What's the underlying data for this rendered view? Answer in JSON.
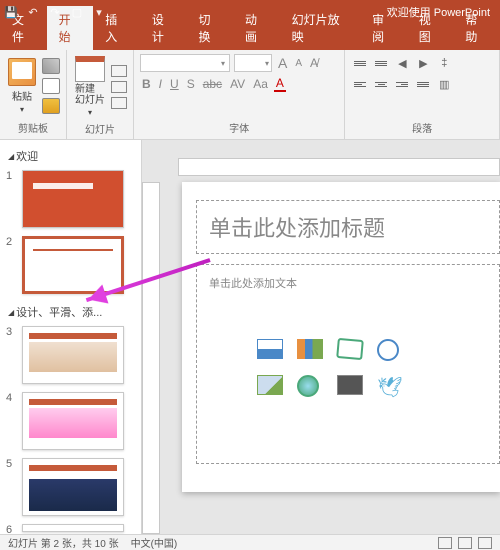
{
  "titlebar": {
    "welcome": "欢迎使用 PowerPoint"
  },
  "tabs": {
    "file": "文件",
    "home": "开始",
    "insert": "插入",
    "design": "设计",
    "transitions": "切换",
    "animations": "动画",
    "slideshow": "幻灯片放映",
    "review": "审阅",
    "view": "视图",
    "help": "帮助"
  },
  "ribbon": {
    "clipboard": {
      "label": "剪贴板",
      "paste": "粘贴"
    },
    "slides": {
      "label": "幻灯片",
      "new_slide": "新建\n幻灯片"
    },
    "font": {
      "label": "字体",
      "bold": "B",
      "italic": "I",
      "underline": "U",
      "strike": "S",
      "abc": "abc",
      "av": "AV",
      "aa": "Aa",
      "a_big": "A",
      "a_small": "A"
    },
    "paragraph": {
      "label": "段落"
    }
  },
  "sections": {
    "welcome": "欢迎",
    "design": "设计、平滑、添..."
  },
  "thumbs": {
    "nums": [
      "1",
      "2",
      "3",
      "4",
      "5",
      "6"
    ]
  },
  "canvas": {
    "title_placeholder": "单击此处添加标题",
    "text_placeholder": "单击此处添加文本"
  },
  "statusbar": {
    "slide_info": "幻灯片 第 2 张，共 10 张",
    "language": "中文(中国)"
  },
  "colors": {
    "brand": "#B7472A",
    "accent": "#C55A3A"
  }
}
